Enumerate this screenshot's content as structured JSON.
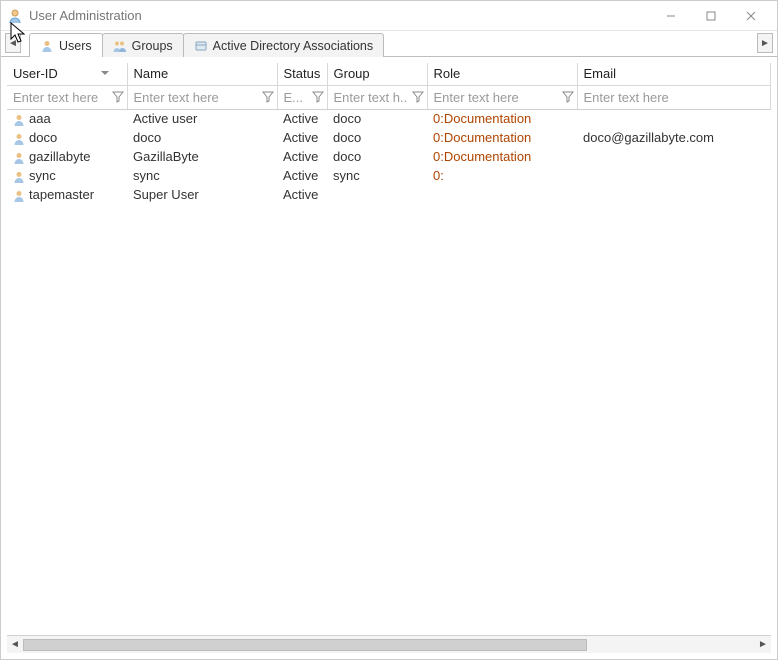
{
  "window": {
    "title": "User Administration"
  },
  "tabs": {
    "items": [
      {
        "label": "Users"
      },
      {
        "label": "Groups"
      },
      {
        "label": "Active Directory Associations"
      }
    ],
    "active_index": 0
  },
  "columns": {
    "user_id": "User-ID",
    "name": "Name",
    "status": "Status",
    "group": "Group",
    "role": "Role",
    "email": "Email"
  },
  "filters": {
    "placeholder_long": "Enter text here",
    "placeholder_status": "E...",
    "placeholder_group": "Enter text h..."
  },
  "rows": [
    {
      "user_id": "aaa",
      "name": "Active user",
      "status": "Active",
      "group": "doco",
      "role": "0:Documentation",
      "email": ""
    },
    {
      "user_id": "doco",
      "name": "doco",
      "status": "Active",
      "group": "doco",
      "role": "0:Documentation",
      "email": "doco@gazillabyte.com"
    },
    {
      "user_id": "gazillabyte",
      "name": "GazillaByte",
      "status": "Active",
      "group": "doco",
      "role": "0:Documentation",
      "email": ""
    },
    {
      "user_id": "sync",
      "name": "sync",
      "status": "Active",
      "group": "sync",
      "role": "0:",
      "email": ""
    },
    {
      "user_id": "tapemaster",
      "name": "Super User",
      "status": "Active",
      "group": "",
      "role": "",
      "email": ""
    }
  ]
}
